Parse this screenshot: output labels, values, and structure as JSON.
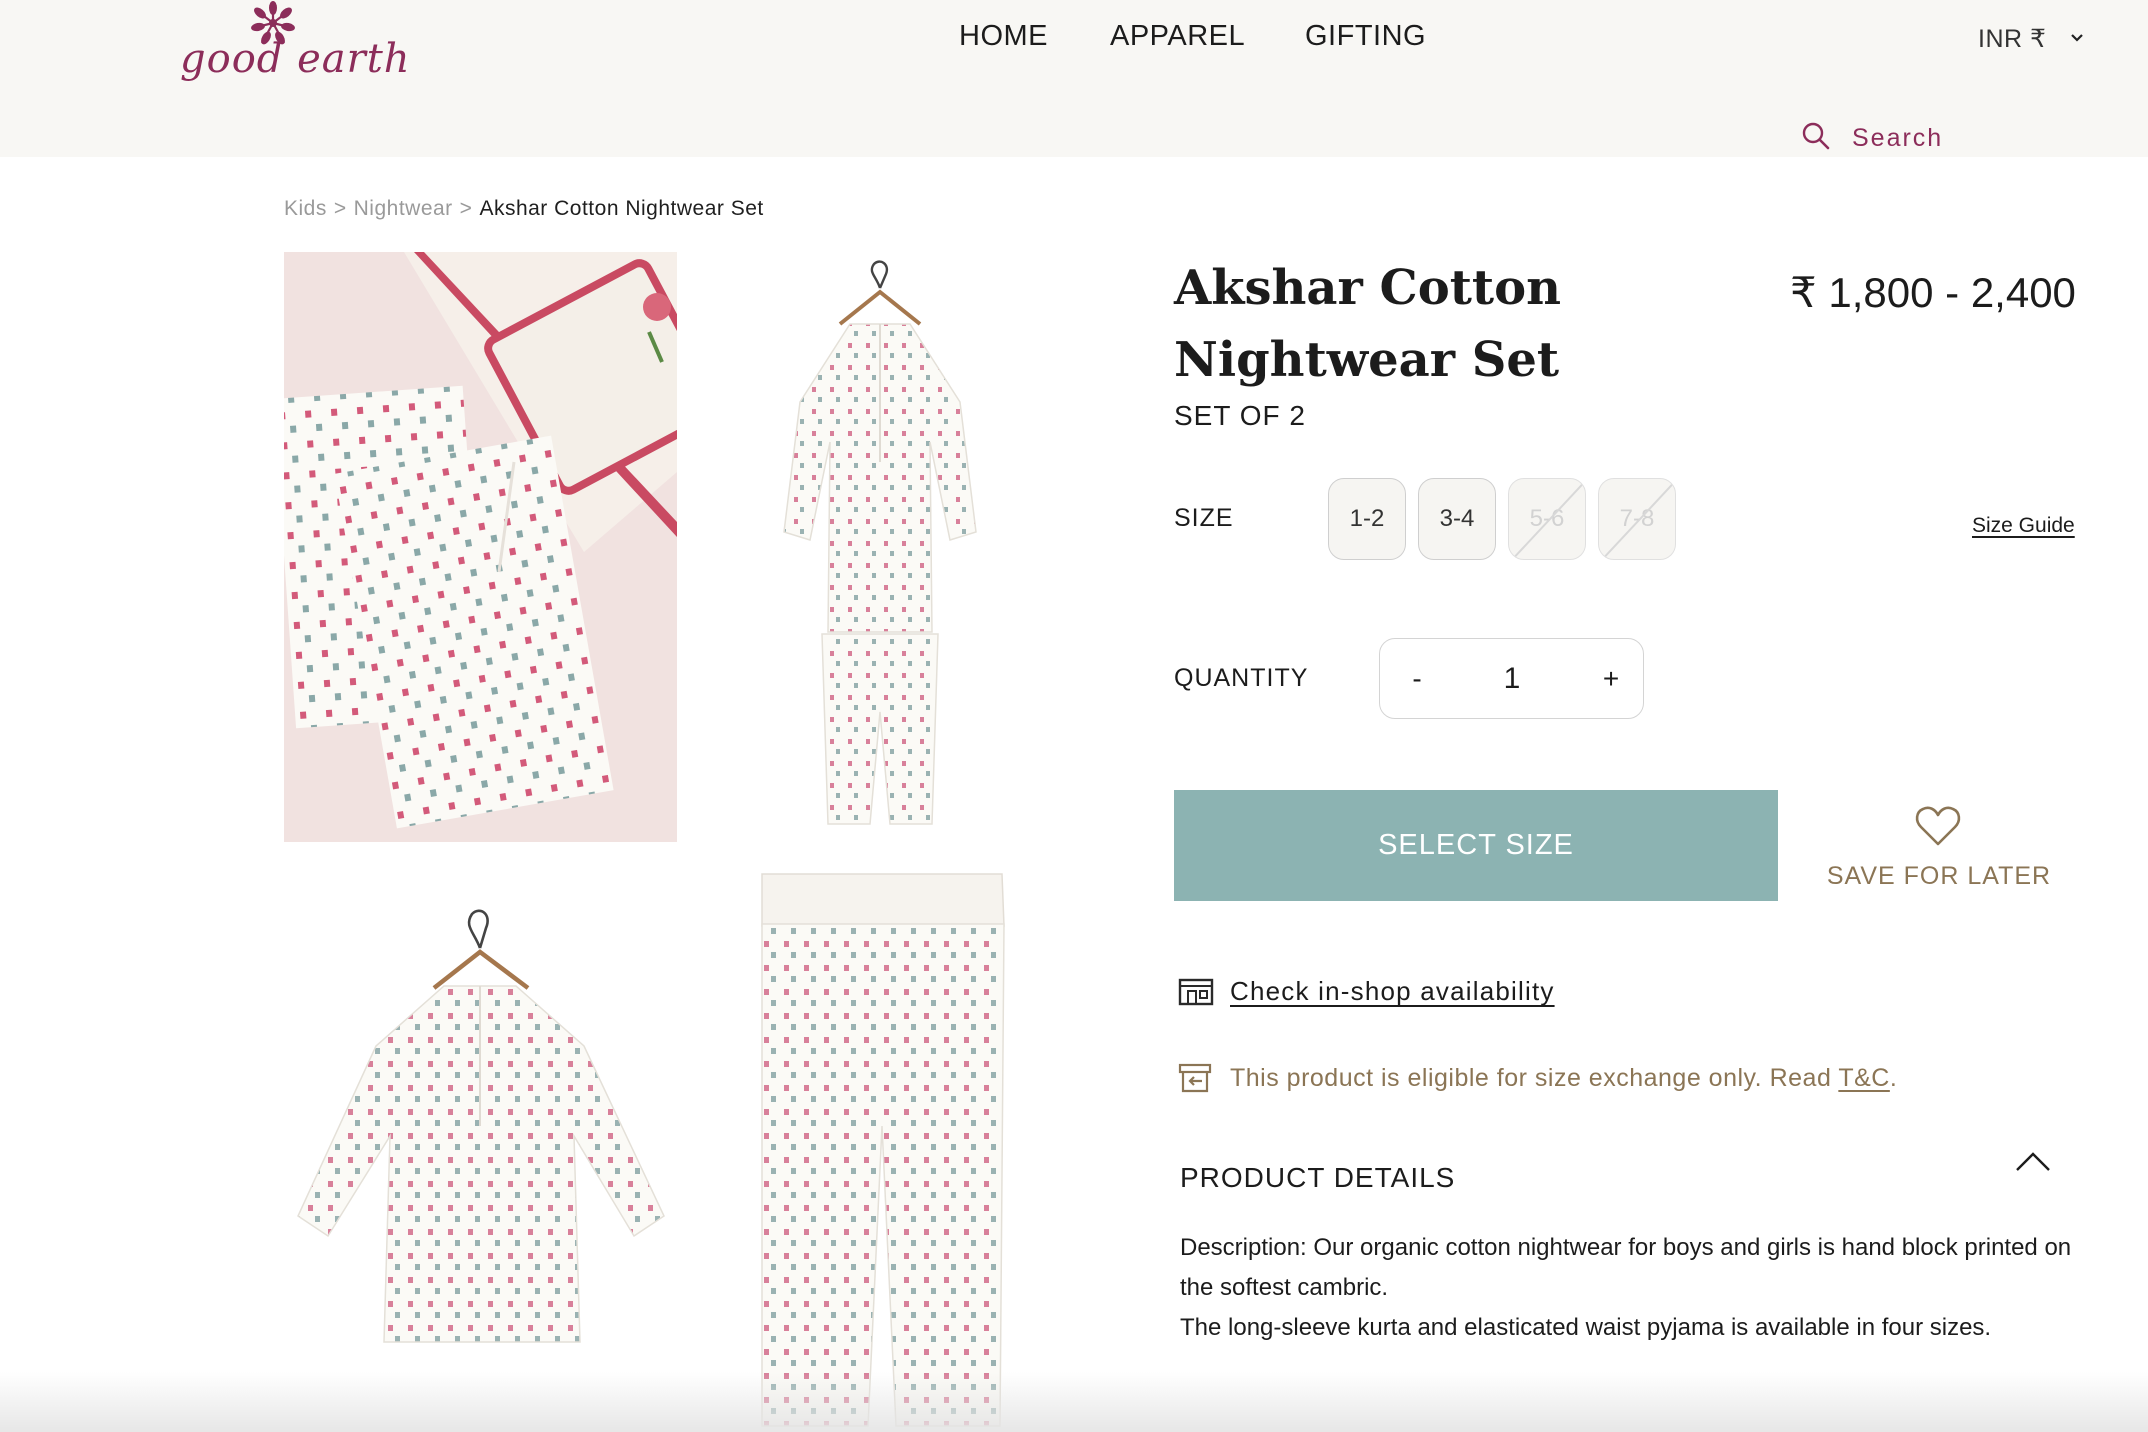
{
  "header": {
    "logo_text": "good earth",
    "nav": {
      "home": "HOME",
      "apparel": "APPAREL",
      "gifting": "GIFTING"
    },
    "currency": "INR ₹",
    "search_label": "Search"
  },
  "breadcrumb": {
    "items": [
      "Kids",
      "Nightwear"
    ],
    "separator": ">",
    "current": "Akshar Cotton Nightwear Set"
  },
  "product": {
    "title": "Akshar Cotton Nightwear Set",
    "price": "₹ 1,800 - 2,400",
    "set_of": "SET OF 2",
    "size_label": "SIZE",
    "sizes": [
      {
        "label": "1-2",
        "available": true
      },
      {
        "label": "3-4",
        "available": true
      },
      {
        "label": "5-6",
        "available": false
      },
      {
        "label": "7-8",
        "available": false
      }
    ],
    "size_guide": "Size Guide",
    "quantity_label": "QUANTITY",
    "quantity": {
      "minus": "-",
      "value": "1",
      "plus": "+"
    },
    "select_size_button": "SELECT SIZE",
    "save_for_later": "SAVE FOR LATER",
    "check_availability": "Check in-shop availability",
    "exchange_note": "This product is eligible for size exchange only. Read ",
    "exchange_link": "T&C",
    "exchange_end": ".",
    "details_title": "PRODUCT DETAILS",
    "description_1": "Description: Our organic cotton nightwear for boys and girls is hand block printed on the softest cambric.",
    "description_2": "The long-sleeve kurta and elasticated waist pyjama is available in four sizes."
  },
  "colors": {
    "brand": "#8c2d5a",
    "button": "#8cb3b2",
    "accent_gold": "#8b7555"
  }
}
